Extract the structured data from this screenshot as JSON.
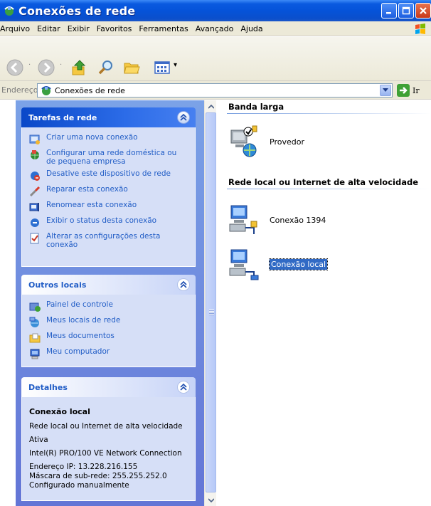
{
  "window": {
    "title": "Conexões de rede"
  },
  "menu": [
    {
      "label": "Arquivo"
    },
    {
      "label": "Editar"
    },
    {
      "label": "Exibir"
    },
    {
      "label": "Favoritos"
    },
    {
      "label": "Ferramentas"
    },
    {
      "label": "Avançado"
    },
    {
      "label": "Ajuda"
    }
  ],
  "address": {
    "label": "Endereço",
    "value": "Conexões de rede",
    "go_label": "Ir"
  },
  "tasks_panel": {
    "title": "Tarefas de rede",
    "items": [
      {
        "label": "Criar uma nova conexão",
        "icon": "new-connection-icon"
      },
      {
        "label": "Configurar uma rede doméstica ou de pequena empresa",
        "icon": "home-network-icon"
      },
      {
        "label": "Desative este dispositivo de rede",
        "icon": "disable-device-icon"
      },
      {
        "label": "Reparar esta conexão",
        "icon": "repair-icon"
      },
      {
        "label": "Renomear esta conexão",
        "icon": "rename-icon"
      },
      {
        "label": "Exibir o status desta conexão",
        "icon": "status-icon"
      },
      {
        "label": "Alterar as configurações desta conexão",
        "icon": "settings-icon"
      }
    ]
  },
  "places_panel": {
    "title": "Outros locais",
    "items": [
      {
        "label": "Painel de controle",
        "icon": "control-panel-icon"
      },
      {
        "label": "Meus locais de rede",
        "icon": "network-places-icon"
      },
      {
        "label": "Meus documentos",
        "icon": "my-documents-icon"
      },
      {
        "label": "Meu computador",
        "icon": "my-computer-icon"
      }
    ]
  },
  "details_panel": {
    "title": "Detalhes",
    "name": "Conexão local",
    "type": "Rede local ou Internet de alta velocidade",
    "status": "Ativa",
    "adapter": "Intel(R) PRO/100 VE Network Connection",
    "ip": "Endereço IP: 13.228.216.155",
    "mask": "Máscara de sub-rede: 255.255.252.0",
    "config": "Configurado manualmente"
  },
  "content": {
    "groups": [
      {
        "header": "Banda larga",
        "items": [
          {
            "label": "Provedor",
            "selected": false
          }
        ]
      },
      {
        "header": "Rede local ou Internet de alta velocidade",
        "items": [
          {
            "label": "Conexão 1394",
            "selected": false
          },
          {
            "label": "Conexão local",
            "selected": true
          }
        ]
      }
    ]
  },
  "colors": {
    "titlebar": "#0553d9",
    "taskpane": "#6375d6",
    "link": "#215dc6",
    "selection": "#316ac5"
  }
}
